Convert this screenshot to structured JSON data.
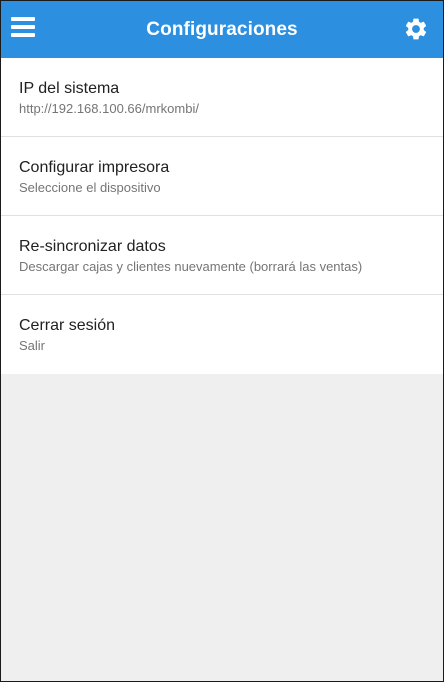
{
  "appbar": {
    "title": "Configuraciones",
    "left_icon": "hamburger-menu-icon",
    "right_icon": "gear-icon",
    "color": "#2d8fe0"
  },
  "settings": {
    "items": [
      {
        "title": "IP del sistema",
        "subtitle": "http://192.168.100.66/mrkombi/"
      },
      {
        "title": "Configurar impresora",
        "subtitle": "Seleccione el dispositivo"
      },
      {
        "title": "Re-sincronizar datos",
        "subtitle": "Descargar cajas y clientes nuevamente (borrará las ventas)"
      },
      {
        "title": "Cerrar sesión",
        "subtitle": "Salir"
      }
    ]
  }
}
